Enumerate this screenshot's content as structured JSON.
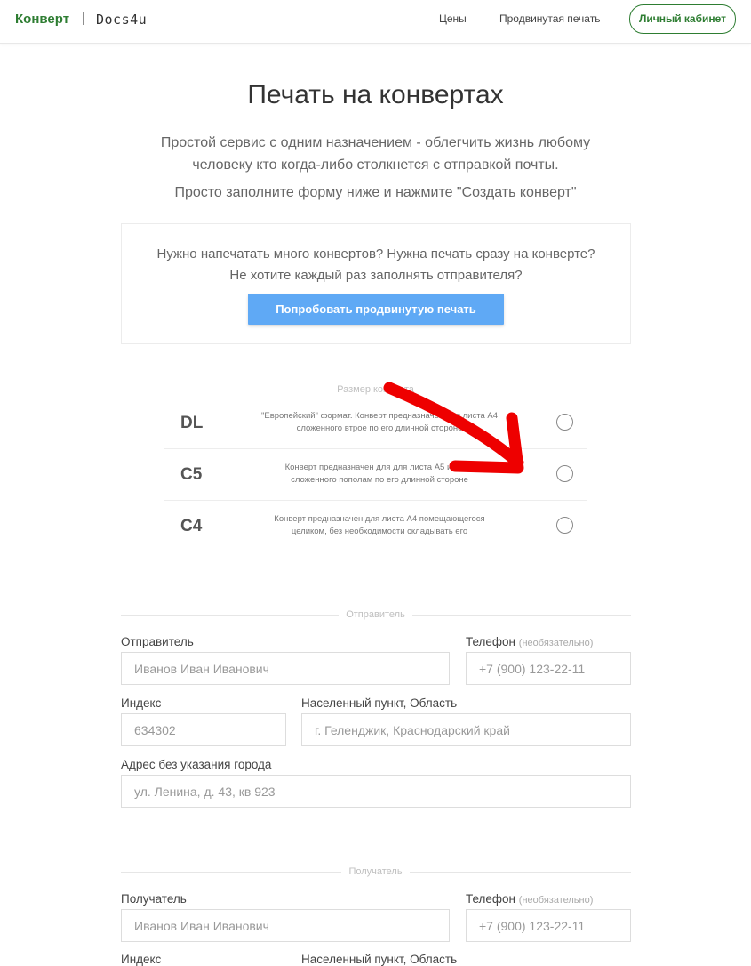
{
  "header": {
    "logo": "Конверт",
    "separator": "|",
    "sublogo": "Docs4u",
    "nav": [
      "Цены",
      "Продвинутая печать"
    ],
    "cabinet_button": "Личный кабинет"
  },
  "hero": {
    "title": "Печать на конвертах",
    "lead1_line1": "Простой сервис с одним назначением - облегчить жизнь любому",
    "lead1_line2": "человеку кто когда-либо столкнется с отправкой почты.",
    "lead2": "Просто заполните форму ниже и нажмите \"Создать конверт\""
  },
  "promo": {
    "line1": "Нужно напечатать много конвертов? Нужна печать сразу на конверте?",
    "line2": "Не хотите каждый раз заполнять отправителя?",
    "button": "Попробовать продвинутую печать"
  },
  "size_section": {
    "label": "Размер конверта",
    "options": [
      {
        "code": "DL",
        "line1": "\"Европейский\" формат. Конверт предназначен для листа А4",
        "line2": "сложенного втрое по его длинной стороне"
      },
      {
        "code": "C5",
        "line1": "Конверт предназначен для для листа А5 или А4",
        "line2": "сложенного пополам по его длинной стороне"
      },
      {
        "code": "C4",
        "line1": "Конверт предназначен для листа А4 помещающегося",
        "line2": "целиком, без необходимости складывать его"
      }
    ]
  },
  "sender": {
    "section_label": "Отправитель",
    "name_label": "Отправитель",
    "name_placeholder": "Иванов Иван Иванович",
    "phone_label": "Телефон",
    "phone_optional": "(необязательно)",
    "phone_placeholder": "+7 (900) 123-22-11",
    "index_label": "Индекс",
    "index_placeholder": "634302",
    "city_label": "Населенный пункт, Область",
    "city_placeholder": "г. Геленджик, Краснодарский край",
    "address_label": "Адрес без указания города",
    "address_placeholder": "ул. Ленина, д. 43, кв 923"
  },
  "recipient": {
    "section_label": "Получатель",
    "name_label": "Получатель",
    "name_placeholder": "Иванов Иван Иванович",
    "phone_label": "Телефон",
    "phone_optional": "(необязательно)",
    "phone_placeholder": "+7 (900) 123-22-11",
    "index_label": "Индекс",
    "city_label": "Населенный пункт, Область"
  },
  "colors": {
    "brand": "#2e7d32",
    "button_blue": "#5fa9f5",
    "annotation_red": "#ee0000"
  }
}
